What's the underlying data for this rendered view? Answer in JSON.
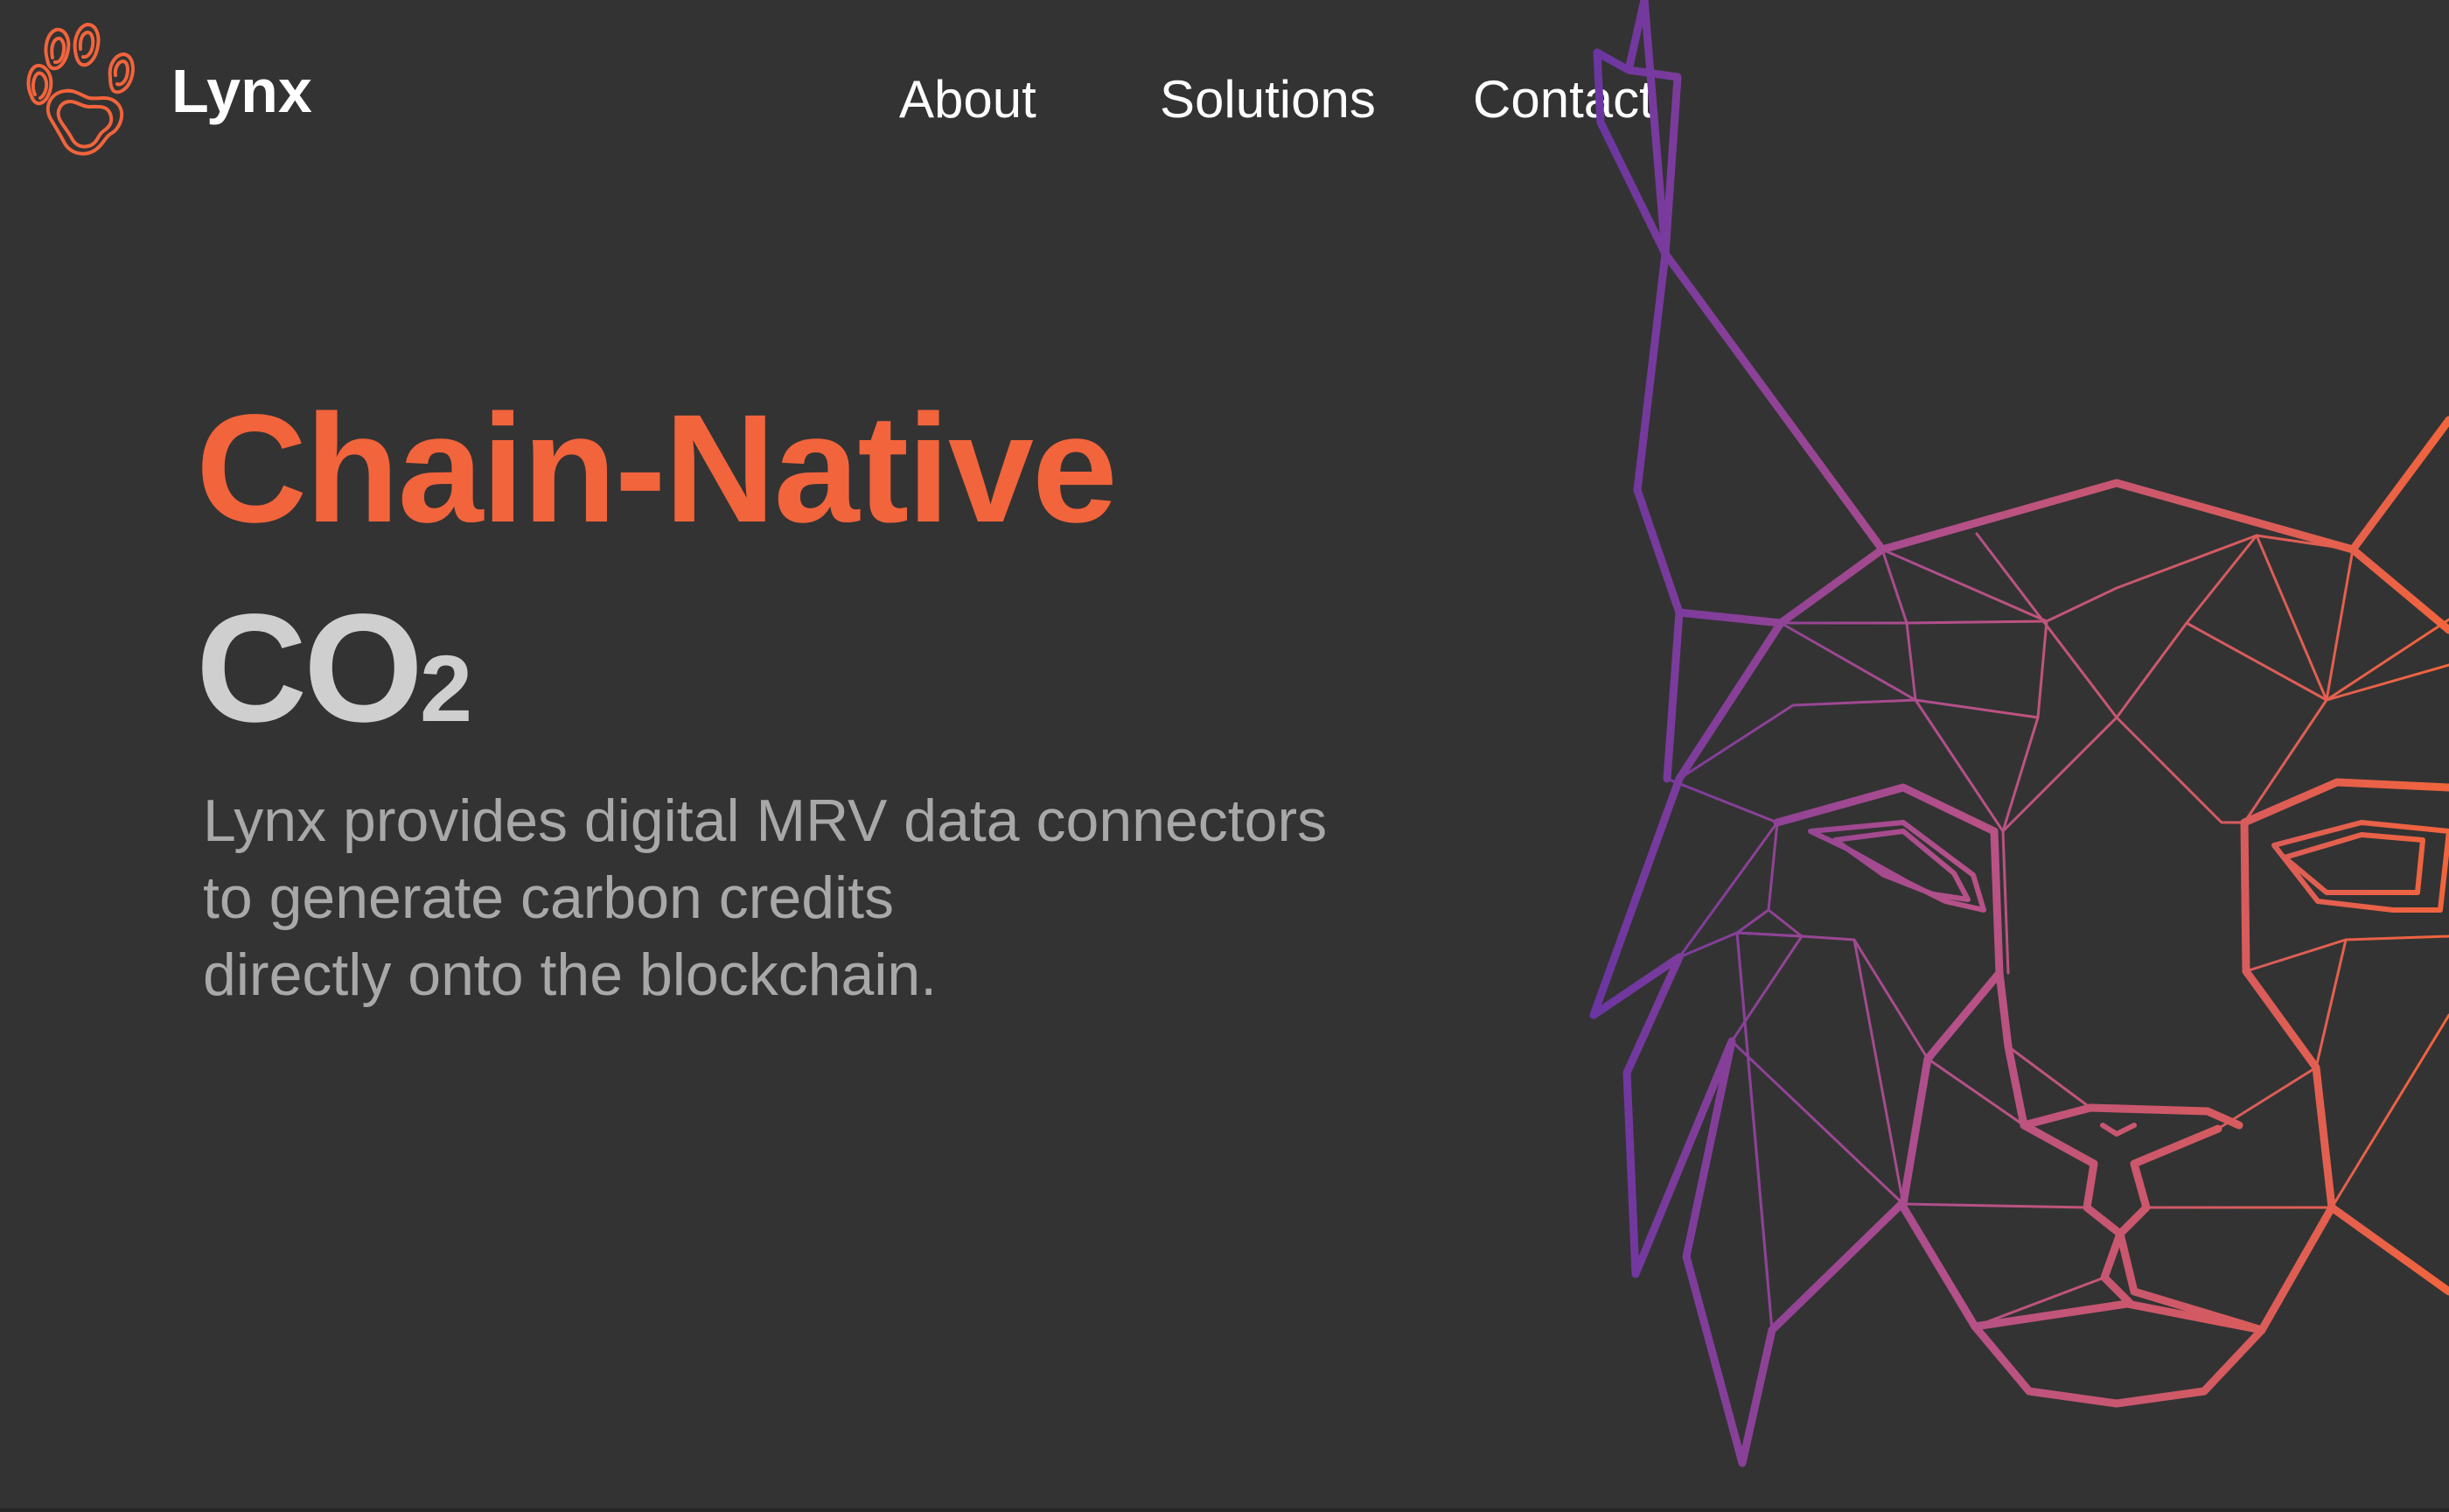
{
  "brand": {
    "name": "Lynx",
    "logo_icon": "paw-icon"
  },
  "nav": {
    "items": [
      {
        "label": "About"
      },
      {
        "label": "Solutions"
      },
      {
        "label": "Contact"
      }
    ]
  },
  "hero": {
    "title": "Chain-Native",
    "co2_main": "CO",
    "co2_sub": "2",
    "description_lines": [
      "Lynx provides digital MRV data connectors",
      "to generate carbon credits",
      "directly onto the blockchain."
    ]
  },
  "artwork": {
    "icon": "lynx-head-illustration",
    "gradient_start": "#6a35a2",
    "gradient_mid": "#b4508a",
    "gradient_end": "#f2643c"
  },
  "colors": {
    "background": "#333333",
    "accent": "#f2643c",
    "heading_secondary": "#cfcfcf",
    "body_text": "#a8a8a8",
    "nav_text": "#ffffff"
  }
}
